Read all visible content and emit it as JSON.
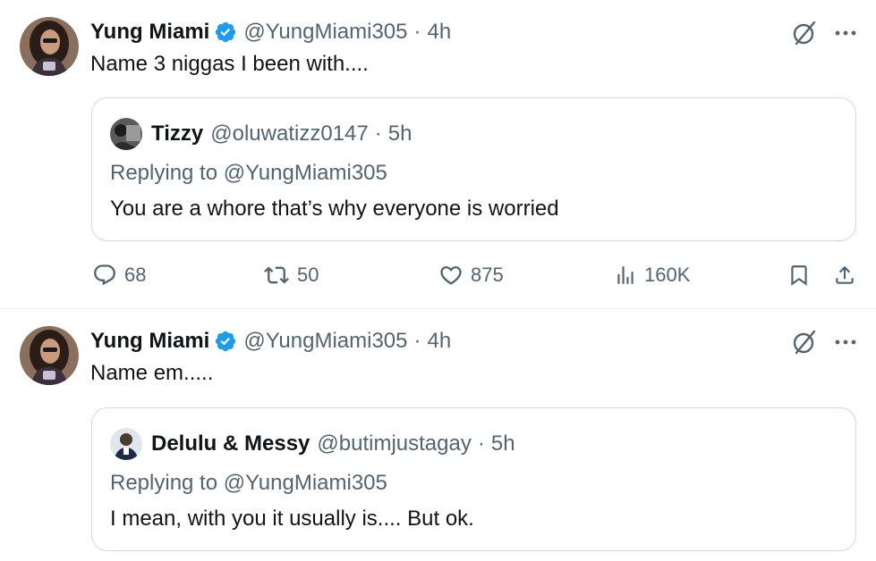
{
  "tweets": [
    {
      "author": {
        "name": "Yung Miami",
        "handle": "@YungMiami305",
        "time": "4h"
      },
      "separator": "·",
      "text": "Name 3 niggas I been with....",
      "quote": {
        "author": {
          "name": "Tizzy",
          "handle": "@oluwatizz0147",
          "time": "5h"
        },
        "separator": "·",
        "replying_to": "Replying to @YungMiami305",
        "text": "You are a whore that’s why everyone is worried"
      },
      "actions": {
        "replies": "68",
        "reposts": "50",
        "likes": "875",
        "views": "160K"
      }
    },
    {
      "author": {
        "name": "Yung Miami",
        "handle": "@YungMiami305",
        "time": "4h"
      },
      "separator": "·",
      "text": "Name em.....",
      "quote": {
        "author": {
          "name": "Delulu & Messy",
          "handle": "@butimjustagay",
          "time": "5h"
        },
        "separator": "·",
        "replying_to": "Replying to @YungMiami305",
        "text": "I mean, with you it usually is.... But ok."
      }
    }
  ],
  "icons": {
    "verified": "verified-badge-icon",
    "grok": "grok-icon",
    "more": "more-icon",
    "reply": "reply-icon",
    "repost": "repost-icon",
    "like": "heart-icon",
    "views": "views-icon",
    "bookmark": "bookmark-icon",
    "share": "share-icon"
  },
  "colors": {
    "verified_blue": "#1d9bf0",
    "secondary_text": "#536471",
    "primary_text": "#0f1419",
    "border": "#cfd9de"
  }
}
